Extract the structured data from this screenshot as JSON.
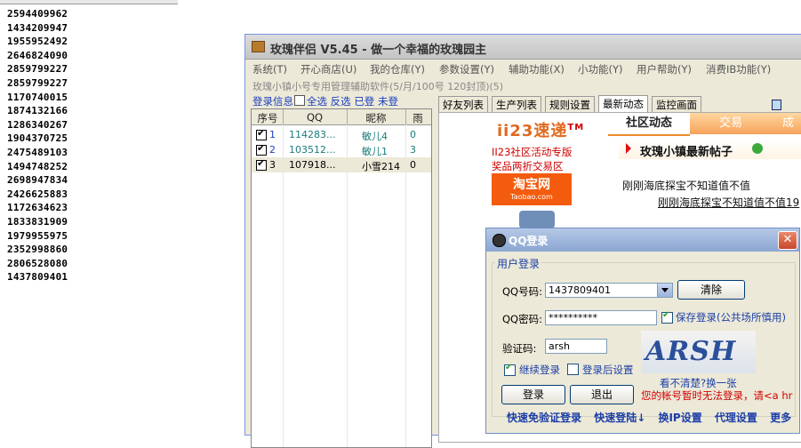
{
  "number_list": [
    "2594409962",
    "1434209947",
    "1955952492",
    "2646824090",
    "2859799227",
    "2859799227",
    "1170740015",
    "1874132166",
    "1286340267",
    "1904370725",
    "2475489103",
    "1494748252",
    "2698947834",
    "2426625883",
    "1172634623",
    "1833831909",
    "1979955975",
    "2352998860",
    "2806528080",
    "1437809401"
  ],
  "main_window": {
    "title": "玫瑰伴侣 V5.45 - 做一个幸福的玫瑰园主",
    "menu": [
      "系统(T)",
      "开心商店(U)",
      "我的仓库(Y)",
      "参数设置(Y)",
      "辅助功能(X)",
      "小功能(Y)",
      "用户帮助(Y)",
      "消费IB功能(Y)"
    ],
    "subtitle": "玫瑰小镇小号专用管理辅助软件(5/月/100号 120封顶)(5)",
    "left_toolbar": {
      "login_info": "登录信息",
      "select_all": "全选",
      "invert": "反选",
      "logged_in": "已登",
      "not_logged_in": "未登"
    },
    "grid": {
      "headers": [
        "序号",
        "QQ",
        "昵称",
        "雨"
      ],
      "rows": [
        {
          "idx": "1",
          "qq": "114283...",
          "nick": "敏儿4",
          "rain": "0"
        },
        {
          "idx": "2",
          "qq": "103512...",
          "nick": "敏儿1",
          "rain": "3"
        },
        {
          "idx": "3",
          "qq": "107918...",
          "nick": "小雪214",
          "rain": "0"
        }
      ]
    },
    "tabs": [
      "好友列表",
      "生产列表",
      "规则设置",
      "最新动态",
      "监控画面"
    ],
    "active_tab": "最新动态",
    "content": {
      "logo": "ii23速递",
      "logo_tm": "TM",
      "promo_line1": "II23社区活动专版",
      "promo_line2": "奖品两折交易区",
      "taobao_cn": "淘宝网",
      "taobao_en": "Taobao.com",
      "community_tabs": [
        "社区动态",
        "交易",
        "成"
      ],
      "news_title": "玫瑰小镇最新帖子",
      "post1": "刚刚海底探宝不知道值不值",
      "post2": "刚刚海底探宝不知道值不值19"
    }
  },
  "qq_dialog": {
    "title": "QQ登录",
    "close": "✕",
    "group_label": "用户登录",
    "qq_label": "QQ号码:",
    "qq_value": "1437809401",
    "clear_button": "清除",
    "pwd_label": "QQ密码:",
    "pwd_value": "**********",
    "save_login": "保存登录(公共场所慎用)",
    "captcha_label": "验证码:",
    "captcha_value": "arsh",
    "captcha_image_text": "ARSH",
    "continue_login": "继续登录",
    "setting_after_login": "登录后设置",
    "unclear": "看不清楚?换一张",
    "login_button": "登录",
    "exit_button": "退出",
    "warning": "您的帐号暂时无法登录，请<a hr",
    "bottom_links": [
      "快速免验证登录",
      "快速登陆↓",
      "换IP设置",
      "代理设置",
      "更多"
    ]
  }
}
